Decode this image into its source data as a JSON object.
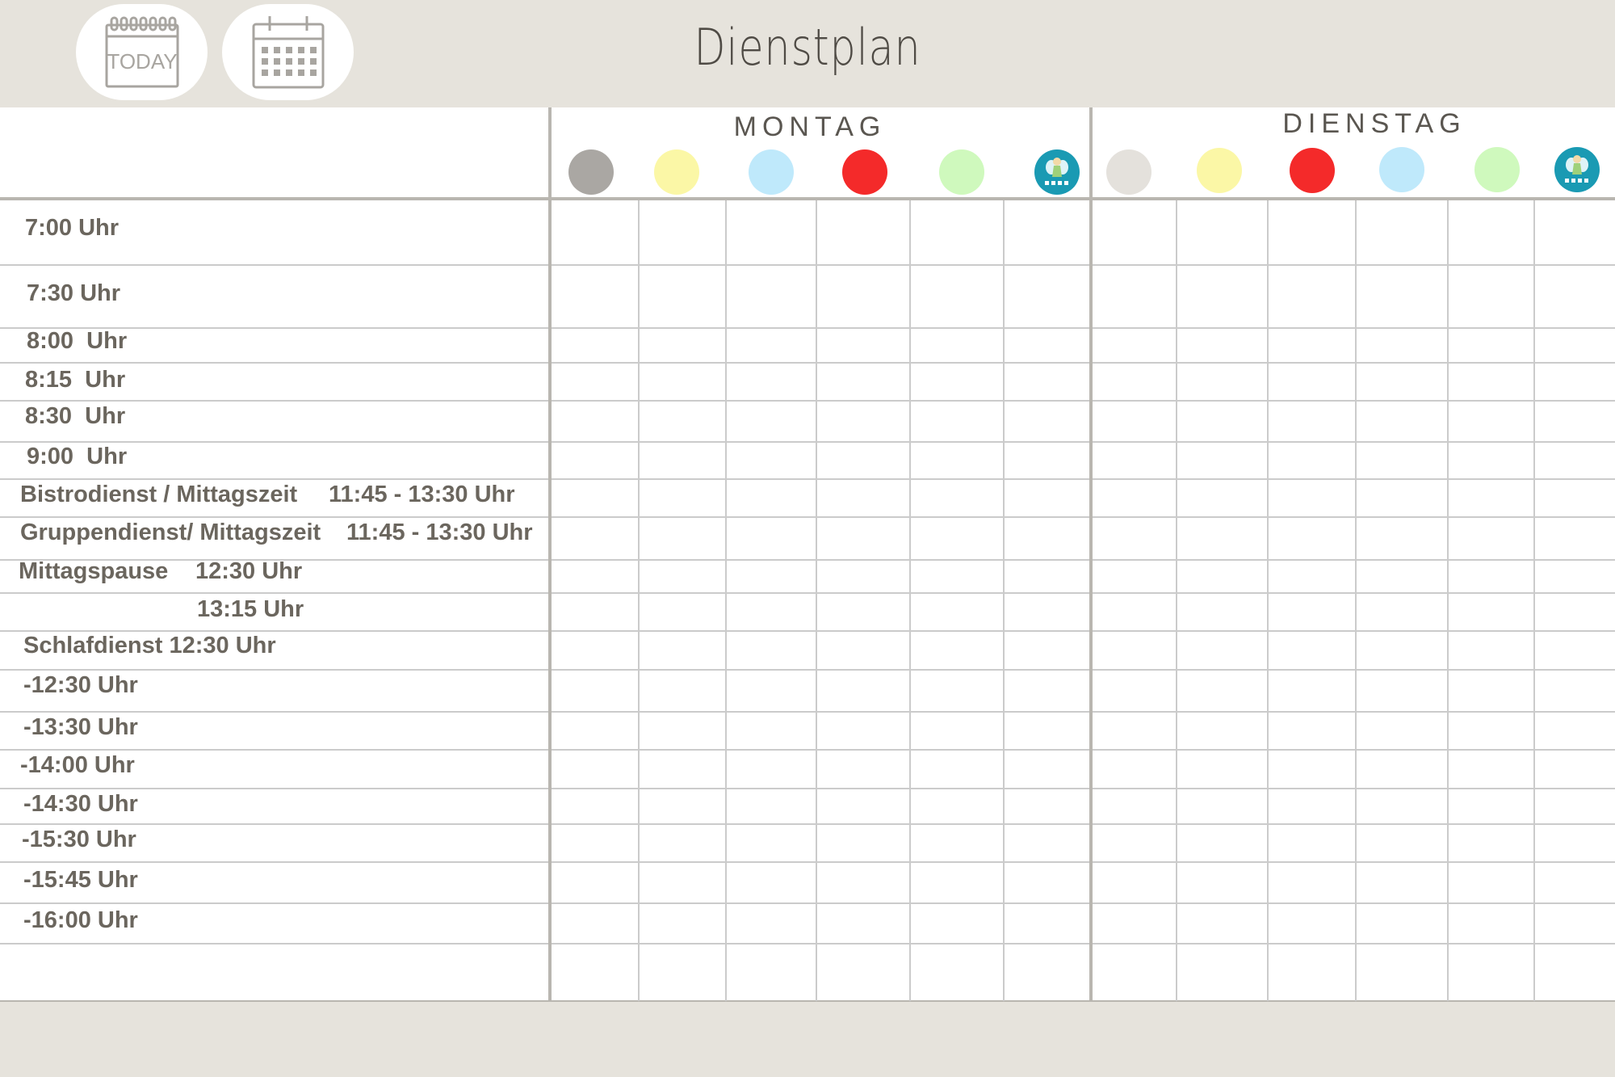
{
  "title": "Dienstplan",
  "header": {
    "today_icon_label": "TODAY",
    "icons": [
      "calendar-today-icon",
      "calendar-month-icon"
    ]
  },
  "days": [
    {
      "name": "MONTAG",
      "colors": [
        {
          "icon": "gray-dot",
          "hex": "#aaa7a3"
        },
        {
          "icon": "yellow-dot",
          "hex": "#fbf7a6"
        },
        {
          "icon": "light-blue-dot",
          "hex": "#bfe9fb"
        },
        {
          "icon": "red-dot",
          "hex": "#f42a2a"
        },
        {
          "icon": "light-green-dot",
          "hex": "#cff9bd"
        },
        {
          "icon": "fairy-badge-icon",
          "hex": "#1a9ab3"
        }
      ]
    },
    {
      "name": "DIENSTAG",
      "colors": [
        {
          "icon": "beige-dot",
          "hex": "#e4e1dc"
        },
        {
          "icon": "yellow-dot",
          "hex": "#fbf7a6"
        },
        {
          "icon": "red-dot",
          "hex": "#f42a2a"
        },
        {
          "icon": "light-blue-dot",
          "hex": "#bfe9fb"
        },
        {
          "icon": "light-green-dot",
          "hex": "#cff9bd"
        },
        {
          "icon": "fairy-badge-icon",
          "hex": "#1a9ab3"
        }
      ]
    }
  ],
  "rows": [
    {
      "label": "7:00 Uhr"
    },
    {
      "label": "7:30 Uhr"
    },
    {
      "label": "8:00  Uhr"
    },
    {
      "label": "8:15  Uhr"
    },
    {
      "label": "8:30  Uhr"
    },
    {
      "label": "9:00  Uhr"
    },
    {
      "label": "Bistrodienst / Mittagszeit",
      "time": "11:45 - 13:30 Uhr"
    },
    {
      "label": "Gruppendienst/ Mittagszeit",
      "time": "11:45 - 13:30 Uhr"
    },
    {
      "label": "Mittagspause",
      "time": "12:30 Uhr"
    },
    {
      "label": "",
      "time": "13:15 Uhr"
    },
    {
      "label": "Schlafdienst 12:30 Uhr"
    },
    {
      "label": "-12:30 Uhr"
    },
    {
      "label": "-13:30 Uhr"
    },
    {
      "label": "-14:00 Uhr"
    },
    {
      "label": "-14:30 Uhr"
    },
    {
      "label": "-15:30 Uhr"
    },
    {
      "label": "-15:45 Uhr"
    },
    {
      "label": "-16:00 Uhr"
    },
    {
      "label": ""
    }
  ],
  "colors": {
    "background": "#e6e3dc",
    "text": "#6b665e",
    "grid": "#cbcbcb",
    "divider": "#b9b6b0"
  }
}
